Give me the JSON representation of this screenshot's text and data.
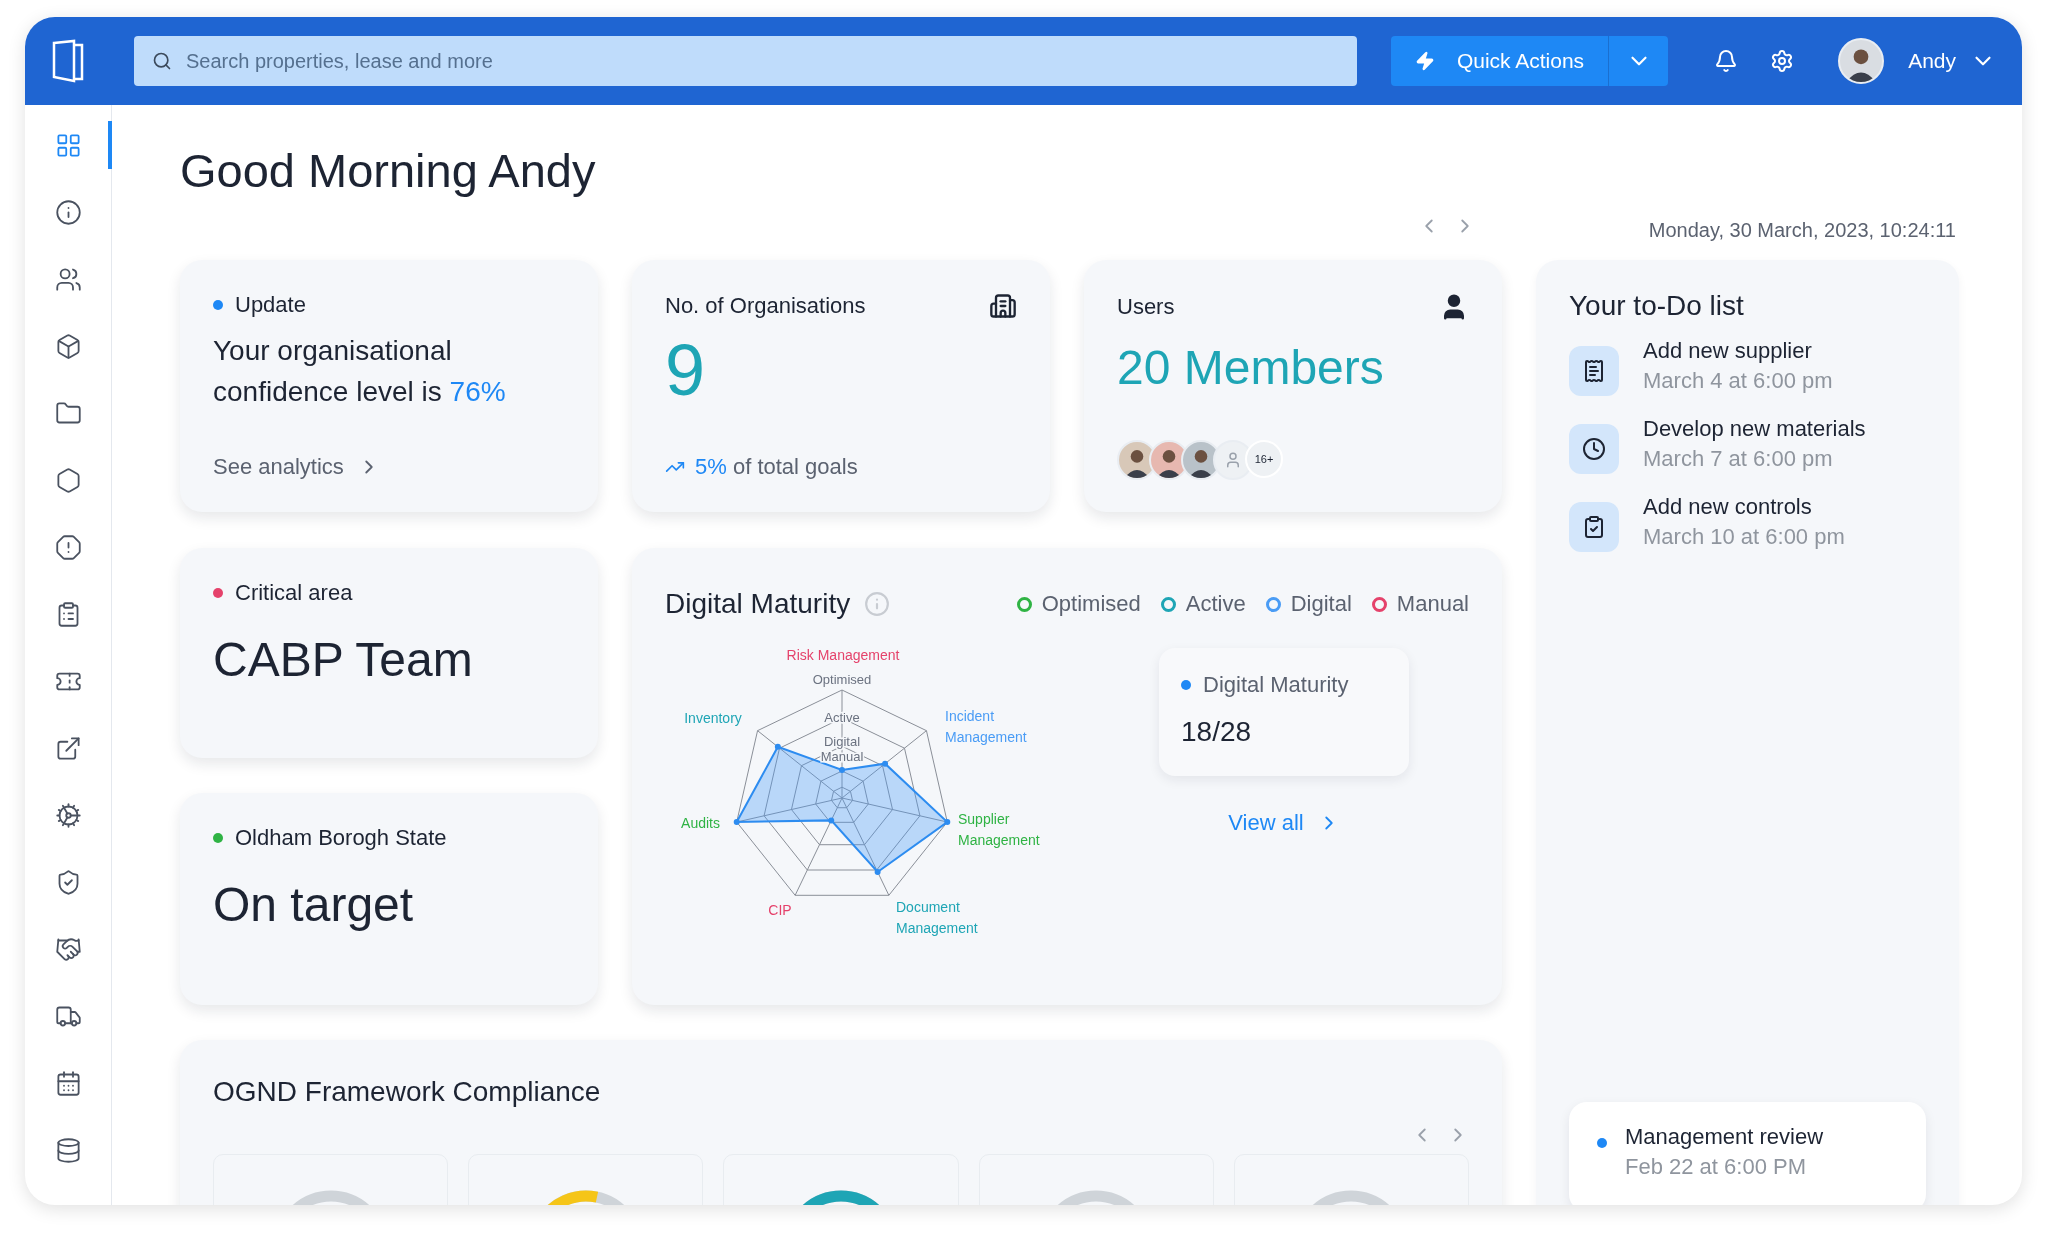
{
  "topbar": {
    "search": {
      "placeholder": "Search properties, lease and more"
    },
    "quick_actions": "Quick Actions",
    "user": "Andy"
  },
  "sidebar": {
    "items": [
      {
        "selected": true
      },
      {
        "selected": false
      },
      {
        "selected": false
      },
      {
        "selected": false
      },
      {
        "selected": false
      },
      {
        "selected": false
      },
      {
        "selected": false
      },
      {
        "selected": false
      },
      {
        "selected": false
      },
      {
        "selected": false
      },
      {
        "selected": false
      },
      {
        "selected": false
      },
      {
        "selected": false
      },
      {
        "selected": false
      },
      {
        "selected": false
      },
      {
        "selected": false
      }
    ]
  },
  "greeting": "Good Morning Andy",
  "date": "Monday, 30 March, 2023, 10:24:11",
  "update_card": {
    "label": "Update",
    "color": "#1e88f5",
    "text": "Your organisational confidence level is",
    "highlight": "76%",
    "link": "See analytics"
  },
  "organisations_card": {
    "label": "No. of Organisations",
    "value": "9",
    "trend_value": "5%",
    "trend_text": "of total goals"
  },
  "users_card": {
    "label": "Users",
    "value": "20 Members",
    "more_count": "16+"
  },
  "status_cards": [
    {
      "label": "Critical area",
      "color": "#e5426b",
      "value": "CABP Team"
    },
    {
      "label": "Oldham Borogh State",
      "color": "#2fb344",
      "value": "On target"
    }
  ],
  "digital_maturity": {
    "title": "Digital Maturity",
    "legend": [
      {
        "label": "Optimised",
        "color": "#2fb344"
      },
      {
        "label": "Active",
        "color": "#1ea5b5"
      },
      {
        "label": "Digital",
        "color": "#4a9cf5"
      },
      {
        "label": "Manual",
        "color": "#e5426b"
      }
    ],
    "levels": [
      "Optimised",
      "Active",
      "Digital",
      "Manual"
    ],
    "axes": [
      {
        "lines": [
          "Risk Management"
        ],
        "color": "#e5426b"
      },
      {
        "lines": [
          "Inventory"
        ],
        "color": "#1ea5b5"
      },
      {
        "lines": [
          "Incident",
          "Management"
        ],
        "color": "#4a9cf5"
      },
      {
        "lines": [
          "Audits"
        ],
        "color": "#2fb344"
      },
      {
        "lines": [
          "Supplier",
          "Management"
        ],
        "color": "#2fb344"
      },
      {
        "lines": [
          "CIP"
        ],
        "color": "#e5426b"
      },
      {
        "lines": [
          "Document",
          "Management"
        ],
        "color": "#1ea5b5"
      }
    ],
    "summary": {
      "label": "Digital Maturity",
      "color": "#1e88f5",
      "value": "18/28"
    },
    "link": "View all"
  },
  "compliance": {
    "title": "OGND Framework Compliance",
    "gauges": [
      {
        "kind": "empty"
      },
      {
        "kind": "partial",
        "color": "#f5c518"
      },
      {
        "kind": "full",
        "color": "#1ea5b5"
      },
      {
        "kind": "empty"
      },
      {
        "kind": "empty"
      }
    ]
  },
  "todo": {
    "title": "Your to-Do list",
    "items": [
      {
        "kind": "list",
        "title": "Add new supplier",
        "time": "March 4 at 6:00 pm"
      },
      {
        "kind": "clock",
        "title": "Develop new materials",
        "time": "March 7 at 6:00 pm"
      },
      {
        "kind": "clipboard",
        "title": "Add new controls",
        "time": "March 10 at 6:00 pm"
      }
    ],
    "review": {
      "title": "Management review",
      "color": "#1e88f5",
      "time": "Feb 22 at 6:00 PM"
    }
  }
}
